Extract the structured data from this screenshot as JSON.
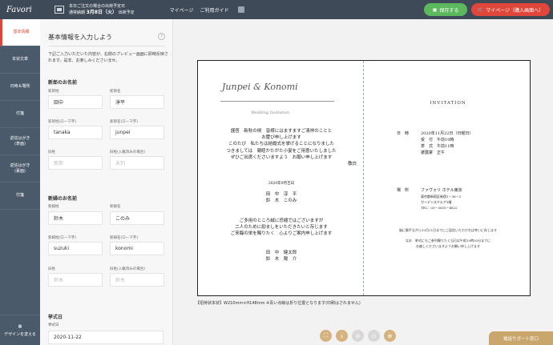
{
  "header": {
    "logo": "Favori",
    "delivery_line1": "本日ご注文の場合の出荷予定日",
    "delivery_label": "通常納期",
    "delivery_date": "3月8日（火）",
    "delivery_suffix": "出荷予定",
    "nav_mypage": "マイページ",
    "nav_guide": "ご利用ガイド",
    "save_label": "保存する",
    "mypage_label": "マイページ（購入画面へ）"
  },
  "sidebar": {
    "items": [
      {
        "label": "基本情報"
      },
      {
        "label": "本状文章"
      },
      {
        "label": "日時＆場所"
      },
      {
        "label": "付箋"
      },
      {
        "label": "返信はがき\n(表面)"
      },
      {
        "label": "返信はがき\n(裏面)"
      },
      {
        "label": "付箋"
      }
    ],
    "design_change": "デザインを変える"
  },
  "form": {
    "title": "基本情報を入力しよう",
    "help": "?",
    "intro": "下記ご入力いただいた内容が、右側のプレビュー画面に即時反映されます。是非、お楽しみくださいませ。",
    "groom_section": "新郎のお名前",
    "bride_section": "新婦のお名前",
    "date_section": "挙式日",
    "labels": {
      "sei": "新郎姓",
      "mei": "新郎名",
      "sei_roma": "新郎姓(ローマ字)",
      "mei_roma": "新郎名(ローマ字)",
      "oldsei": "旧姓",
      "oldmei": "旧姓(入籍済みの場合)",
      "b_sei": "新婦姓",
      "b_mei": "新婦名",
      "b_sei_roma": "新婦姓(ローマ字)",
      "b_mei_roma": "新婦名(ローマ字)",
      "b_oldsei": "旧姓",
      "b_oldmei": "旧姓(入籍済みの場合)",
      "date": "挙式日"
    },
    "values": {
      "groom_sei": "田中",
      "groom_mei": "淳平",
      "groom_sei_roma": "tanaka",
      "groom_mei_roma": "junpei",
      "groom_old_sei_ph": "新郎",
      "groom_old_mei_ph": "未列",
      "bride_sei": "鈴木",
      "bride_mei": "このみ",
      "bride_sei_roma": "suzuki",
      "bride_mei_roma": "konomi",
      "bride_old_sei_ph": "鈴木",
      "bride_old_mei_ph": "鈴木",
      "date": "2020-11-22"
    }
  },
  "preview": {
    "script_names": "Junpei & Konomi",
    "script_sub": "Wedding Invitation",
    "message": [
      "謹啓　新秋の候　皆様にはますますご清祥のことと",
      "お慶び申し上げます",
      "このたび　私たちは結婚式を挙げることになりました",
      "つきましては　親睦かたがた小宴をご用意いたしました",
      "ぜひご出席くださいますよう　お願い申し上げます",
      "敬白"
    ],
    "date_line": "2020年9月吉日",
    "names1": "田　中　淳　平",
    "names2": "鈴　木　このみ",
    "message2": [
      "ご多用のところ誠に恐縮ではございますが",
      "二人のために励ましをいただきたいと存じます",
      "ご来臨の栄を賜りたく　心よりご案内申し上げます"
    ],
    "parents1": "田　中　健太郎",
    "parents2": "鈴　木　陽　介",
    "invitation_title": "INVITATION",
    "date_label": "日　時",
    "date_value": "2020年11月22日（日曜日）",
    "reception_label": "受　付",
    "reception_value": "午前10時",
    "ceremony_label": "挙　式",
    "ceremony_value": "午前11時",
    "banquet_label": "披露宴",
    "banquet_value": "正午",
    "place_label": "場　所",
    "place_value": "ファヴォリ ホテル東京",
    "address1": "東京都新宿区新宿1－36－3",
    "address2": "ガーデンスクエア3階",
    "tel": "TEL：03－3555－4622",
    "note1": "誠に勝手ながら10月21日までにご返信いただければ幸いに存じます",
    "note2": "なお　挙式にもご参列賜りたく当日は午前10時30分までに",
    "note3": "お越しくださいますようお願い申し上げます",
    "spec": "【招待状本状】W210mm×H148mm ※青い点線は折り位置となります(印刷はされません)",
    "support": "電話サポート窓口"
  },
  "colors": {
    "header": "#3e4a57",
    "sidebar": "#4a5a6a",
    "save": "#5cb85c",
    "mypage": "#e0473a",
    "accent_gold": "#d6b27e",
    "fold_line": "#7fb0d8"
  }
}
